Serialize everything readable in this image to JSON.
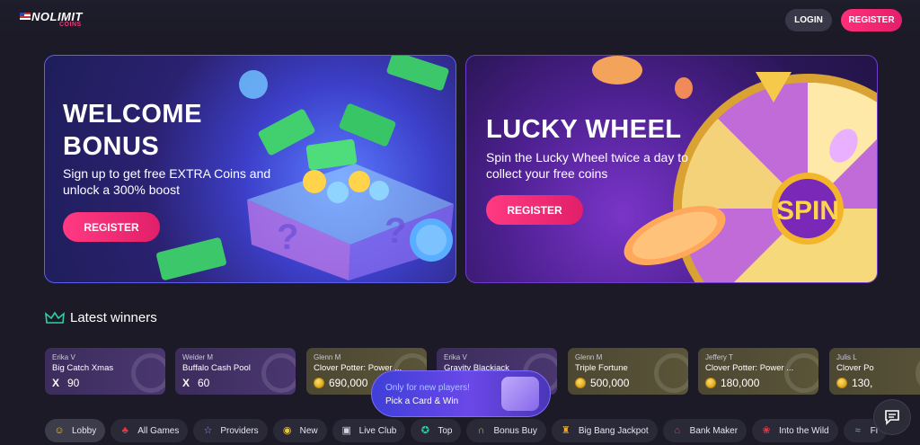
{
  "brand": {
    "logo_main": "NOLIMIT",
    "logo_sub": "COINS"
  },
  "header": {
    "login_label": "LOGIN",
    "register_label": "REGISTER"
  },
  "banners": [
    {
      "title_line1": "WELCOME",
      "title_line2": "BONUS",
      "text_line1": "Sign up to get free EXTRA Coins and",
      "text_line2": "unlock a 300% boost",
      "button_label": "REGISTER"
    },
    {
      "title": "LUCKY WHEEL",
      "text_line1": "Spin the Lucky Wheel twice a day to",
      "text_line2": "collect your free coins",
      "button_label": "REGISTER",
      "wheel_label": "SPIN"
    }
  ],
  "winners": {
    "title": "Latest winners",
    "items": [
      {
        "name": "Erika V",
        "game": "Big Catch Xmas",
        "amount": "90",
        "currency": "x",
        "style": "purple"
      },
      {
        "name": "Welder M",
        "game": "Buffalo Cash Pool",
        "amount": "60",
        "currency": "x",
        "style": "purple"
      },
      {
        "name": "Glenn M",
        "game": "Clover Potter: Power ...",
        "amount": "690,000",
        "currency": "coin",
        "style": "olive"
      },
      {
        "name": "Erika V",
        "game": "Gravity Blackjack",
        "amount": "",
        "currency": "x",
        "style": "purple"
      },
      {
        "name": "Glenn M",
        "game": "Triple Fortune",
        "amount": "500,000",
        "currency": "coin",
        "style": "olive"
      },
      {
        "name": "Jeffery T",
        "game": "Clover Potter: Power ...",
        "amount": "180,000",
        "currency": "coin",
        "style": "olive"
      },
      {
        "name": "Julis L",
        "game": "Clover Po",
        "amount": "130,",
        "currency": "coin",
        "style": "olive"
      }
    ]
  },
  "promo": {
    "line1": "Only for new players!",
    "line2": "Pick a Card & Win"
  },
  "categories": [
    {
      "label": "Lobby",
      "icon": "lobby-icon",
      "glyph": "☺",
      "color": "#f5c518"
    },
    {
      "label": "All Games",
      "icon": "cherries-icon",
      "glyph": "♣",
      "color": "#e5394a"
    },
    {
      "label": "Providers",
      "icon": "star-icon",
      "glyph": "☆",
      "color": "#b07cff"
    },
    {
      "label": "New",
      "icon": "new-icon",
      "glyph": "◉",
      "color": "#f5c518"
    },
    {
      "label": "Live Club",
      "icon": "cards-icon",
      "glyph": "▣",
      "color": "#cfd3e0"
    },
    {
      "label": "Top",
      "icon": "medal-icon",
      "glyph": "✪",
      "color": "#2fd0a8"
    },
    {
      "label": "Bonus Buy",
      "icon": "horseshoe-icon",
      "glyph": "∩",
      "color": "#f5a623"
    },
    {
      "label": "Big Bang Jackpot",
      "icon": "trophy-icon",
      "glyph": "♜",
      "color": "#f5a623"
    },
    {
      "label": "Bank Maker",
      "icon": "bank-icon",
      "glyph": "⌂",
      "color": "#e5394a"
    },
    {
      "label": "Into the Wild",
      "icon": "paw-icon",
      "glyph": "❀",
      "color": "#e5394a"
    },
    {
      "label": "Fi",
      "icon": "fish-icon",
      "glyph": "≈",
      "color": "#2fd0a8"
    }
  ]
}
